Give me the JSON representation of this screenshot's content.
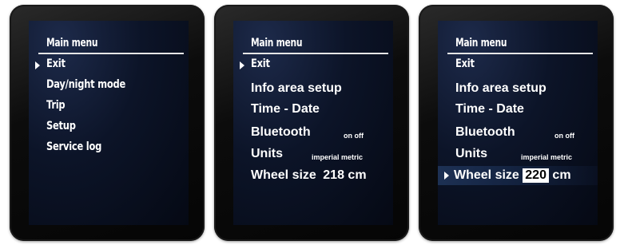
{
  "screen1": {
    "title": "Main menu",
    "items": [
      "Exit",
      "Day/night mode",
      "Trip",
      "Setup",
      "Service log"
    ]
  },
  "screen2": {
    "title": "Main menu",
    "exit": "Exit",
    "info_area": "Info area setup",
    "time_date": "Time - Date",
    "bluetooth": "Bluetooth",
    "bluetooth_options": "on off",
    "units": "Units",
    "units_options": "imperial metric",
    "wheel_label": "Wheel size",
    "wheel_value": "218",
    "wheel_unit": "cm"
  },
  "screen3": {
    "title": "Main menu",
    "exit": "Exit",
    "info_area": "Info area setup",
    "time_date": "Time - Date",
    "bluetooth": "Bluetooth",
    "bluetooth_options": "on off",
    "units": "Units",
    "units_options": "imperial metric",
    "wheel_label": "Wheel size",
    "wheel_value": "220",
    "wheel_unit": "cm"
  }
}
